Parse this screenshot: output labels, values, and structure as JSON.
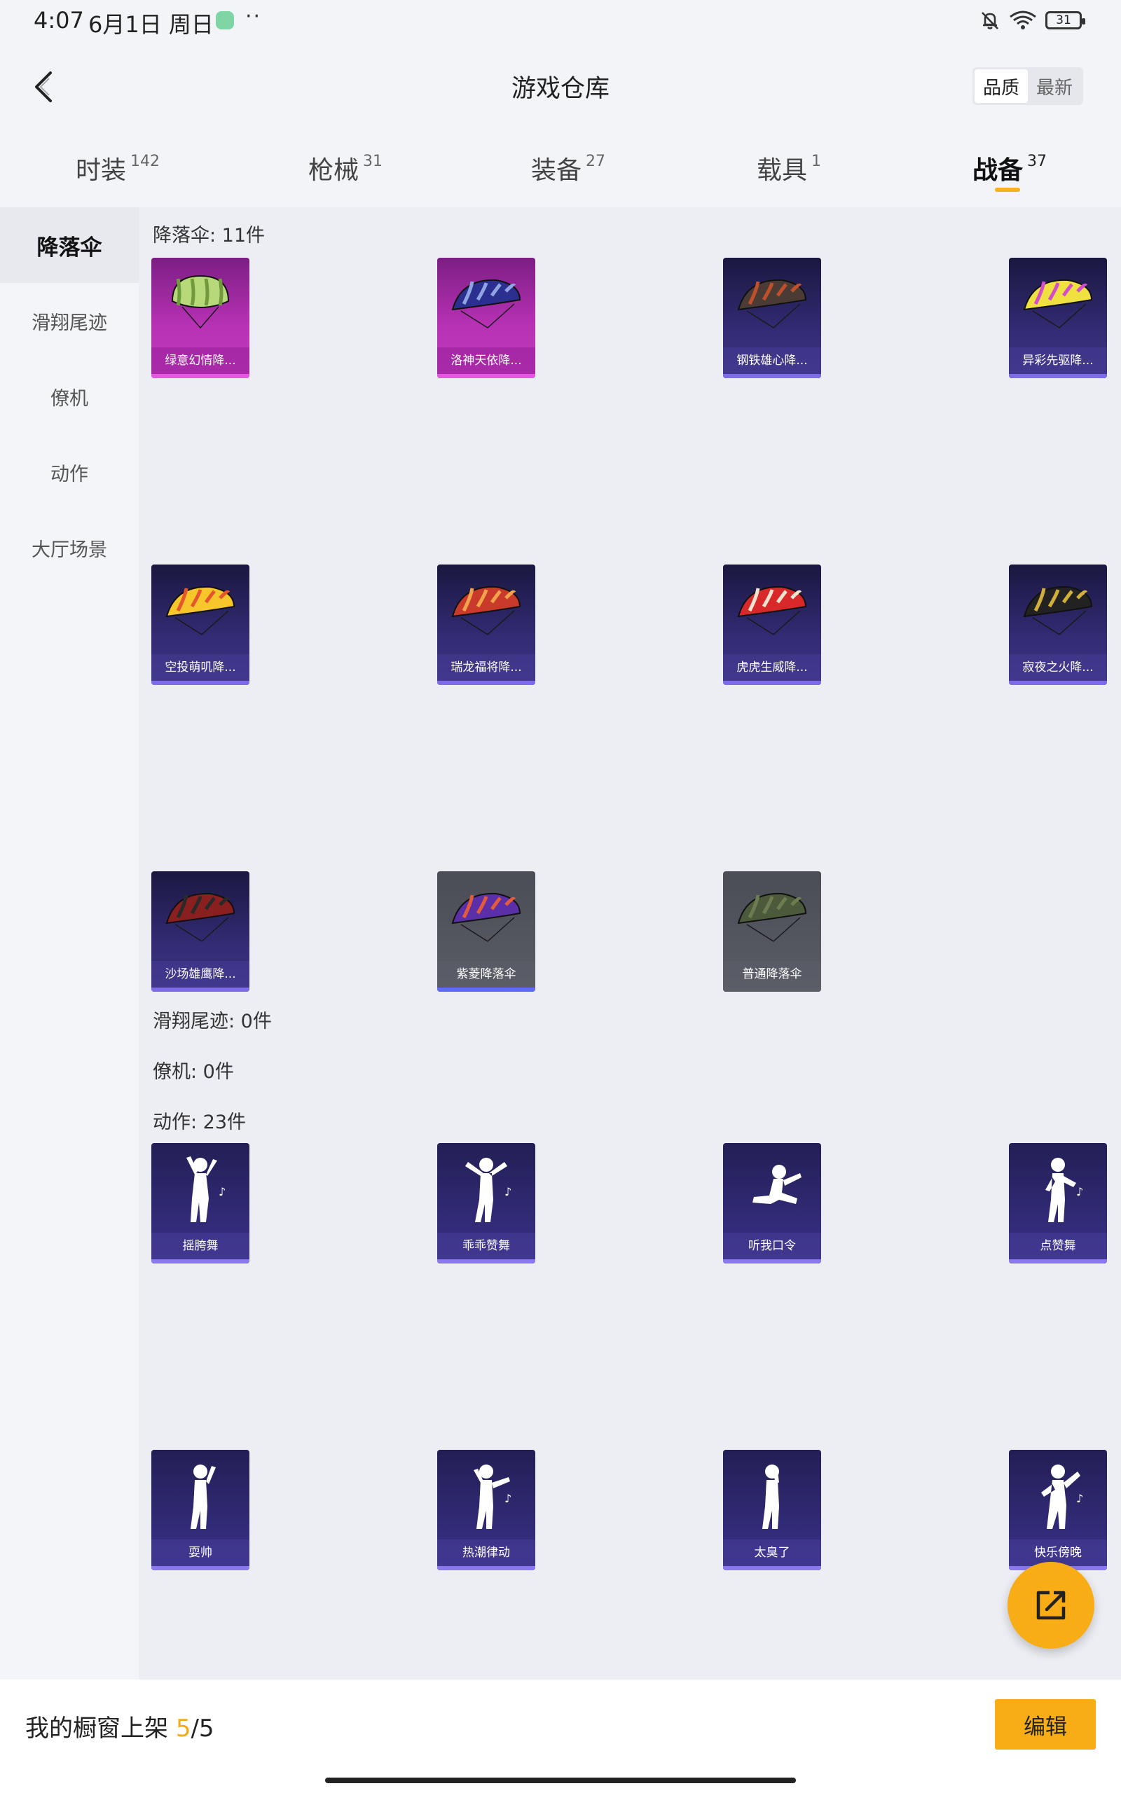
{
  "status_bar": {
    "time": "4:07",
    "date": "6月1日 周日",
    "dots": "··",
    "battery": "31"
  },
  "header": {
    "title": "游戏仓库",
    "sort_options": [
      "品质",
      "最新"
    ],
    "sort_active": "品质"
  },
  "tabs": [
    {
      "label": "时装",
      "count": "142"
    },
    {
      "label": "枪械",
      "count": "31"
    },
    {
      "label": "装备",
      "count": "27"
    },
    {
      "label": "载具",
      "count": "1"
    },
    {
      "label": "战备",
      "count": "37",
      "active": true
    }
  ],
  "sidebar": {
    "items": [
      {
        "label": "降落伞",
        "active": true
      },
      {
        "label": "滑翔尾迹"
      },
      {
        "label": "僚机"
      },
      {
        "label": "动作"
      },
      {
        "label": "大厅场景"
      }
    ]
  },
  "sections": {
    "parachute": {
      "heading": "降落伞: 11件",
      "items": [
        {
          "name": "绿意幻情降...",
          "rarity": "purple",
          "icon": "parachute-icon"
        },
        {
          "name": "洛神天依降...",
          "rarity": "purple",
          "icon": "parachute-icon"
        },
        {
          "name": "钢铁雄心降...",
          "rarity": "blue",
          "icon": "parachute-icon"
        },
        {
          "name": "异彩先驱降...",
          "rarity": "blue",
          "icon": "parachute-icon"
        },
        {
          "name": "空投萌叽降...",
          "rarity": "blue",
          "icon": "parachute-icon"
        },
        {
          "name": "瑞龙福将降...",
          "rarity": "blue",
          "icon": "parachute-icon"
        },
        {
          "name": "虎虎生威降...",
          "rarity": "blue",
          "icon": "parachute-icon"
        },
        {
          "name": "寂夜之火降...",
          "rarity": "blue",
          "icon": "parachute-icon"
        },
        {
          "name": "沙场雄鹰降...",
          "rarity": "blue",
          "icon": "parachute-icon"
        },
        {
          "name": "紫菱降落伞",
          "rarity": "gray",
          "icon": "parachute-icon"
        },
        {
          "name": "普通降落伞",
          "rarity": "gray",
          "icon": "parachute-icon"
        }
      ]
    },
    "trail": {
      "heading": "滑翔尾迹: 0件"
    },
    "wingman": {
      "heading": "僚机: 0件"
    },
    "emote": {
      "heading": "动作: 23件",
      "items": [
        {
          "name": "摇胯舞",
          "icon": "dance-pose-icon"
        },
        {
          "name": "乖乖赞舞",
          "icon": "dance-pose-icon"
        },
        {
          "name": "听我口令",
          "icon": "dance-pose-icon"
        },
        {
          "name": "点赞舞",
          "icon": "dance-pose-icon"
        },
        {
          "name": "耍帅",
          "icon": "dance-pose-icon"
        },
        {
          "name": "热潮律动",
          "icon": "dance-pose-icon"
        },
        {
          "name": "太臭了",
          "icon": "dance-pose-icon"
        },
        {
          "name": "快乐傍晚",
          "icon": "dance-pose-icon"
        }
      ]
    }
  },
  "bottom_bar": {
    "label": "我的橱窗上架 ",
    "count_current": "5",
    "count_total": "/5",
    "edit_label": "编辑"
  },
  "colors": {
    "accent": "#f8ad17",
    "rarity_purple": "#b631b3",
    "rarity_blue": "#332b74",
    "rarity_gray": "#5a5c66"
  }
}
